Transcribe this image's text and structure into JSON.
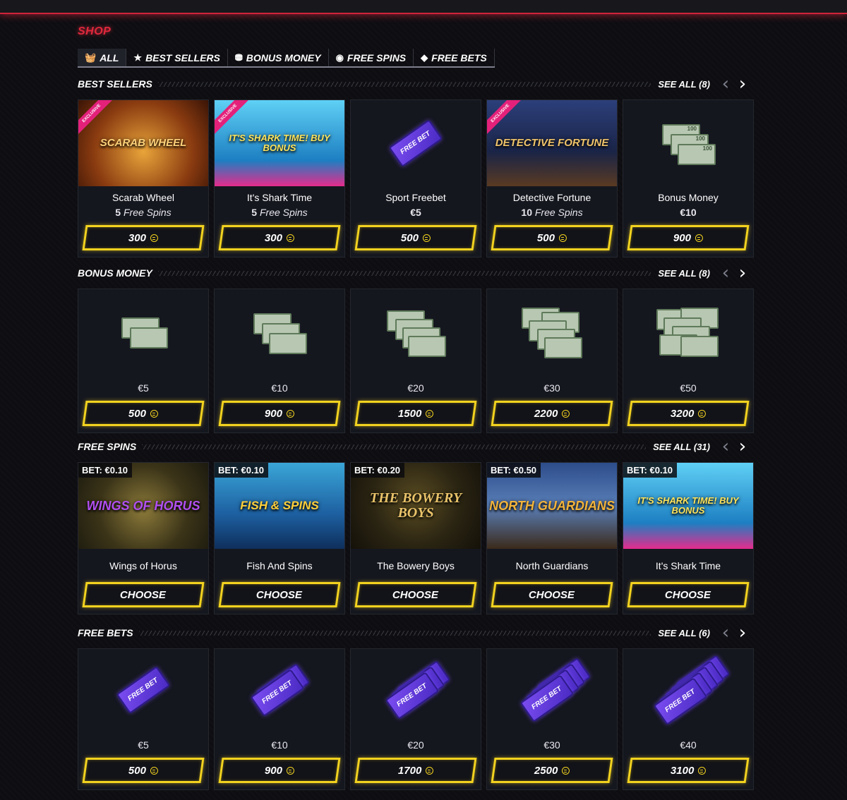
{
  "shop_title": "SHOP",
  "tabs": [
    {
      "icon": "basket-icon",
      "label": "ALL"
    },
    {
      "icon": "star-icon",
      "label": "BEST SELLERS"
    },
    {
      "icon": "coins-icon",
      "label": "BONUS MONEY"
    },
    {
      "icon": "spin-icon",
      "label": "FREE SPINS"
    },
    {
      "icon": "ticket-icon",
      "label": "FREE BETS"
    }
  ],
  "sections": {
    "best_sellers": {
      "title": "BEST SELLERS",
      "see_all": "SEE ALL (8)",
      "items": [
        {
          "image_label": "SCARAB WHEEL",
          "ribbon": "EXCLUSIVE",
          "name": "Scarab Wheel",
          "sub_num": "5",
          "sub_text": " Free Spins",
          "price": "300"
        },
        {
          "image_label": "IT'S SHARK TIME! BUY BONUS",
          "ribbon": "EXCLUSIVE",
          "name": "It's Shark Time",
          "sub_num": "5",
          "sub_text": " Free Spins",
          "price": "300"
        },
        {
          "image_label": "FREE BET",
          "ribbon": "",
          "name": "Sport Freebet",
          "sub_num": "€5",
          "sub_text": "",
          "price": "500"
        },
        {
          "image_label": "DETECTIVE FORTUNE",
          "ribbon": "EXCLUSIVE",
          "name": "Detective Fortune",
          "sub_num": "10",
          "sub_text": " Free Spins",
          "price": "500"
        },
        {
          "image_label": "100",
          "ribbon": "",
          "name": "Bonus Money",
          "sub_num": "€10",
          "sub_text": "",
          "price": "900"
        }
      ]
    },
    "bonus_money": {
      "title": "BONUS MONEY",
      "see_all": "SEE ALL (8)",
      "items": [
        {
          "value": "€5",
          "price": "500"
        },
        {
          "value": "€10",
          "price": "900"
        },
        {
          "value": "€20",
          "price": "1500"
        },
        {
          "value": "€30",
          "price": "2200"
        },
        {
          "value": "€50",
          "price": "3200"
        }
      ]
    },
    "free_spins": {
      "title": "FREE SPINS",
      "see_all": "SEE ALL (31)",
      "items": [
        {
          "bet": "BET: €0.10",
          "image_label": "WINGS OF HORUS",
          "name": "Wings of Horus",
          "button": "CHOOSE"
        },
        {
          "bet": "BET: €0.10",
          "image_label": "FISH & SPINS",
          "name": "Fish And Spins",
          "button": "CHOOSE"
        },
        {
          "bet": "BET: €0.20",
          "image_label": "THE BOWERY BOYS",
          "name": "The Bowery Boys",
          "button": "CHOOSE"
        },
        {
          "bet": "BET: €0.50",
          "image_label": "NORTH GUARDIANS",
          "name": "North Guardians",
          "button": "CHOOSE"
        },
        {
          "bet": "BET: €0.10",
          "image_label": "IT'S SHARK TIME! BUY BONUS",
          "name": "It's Shark Time",
          "button": "CHOOSE"
        }
      ]
    },
    "free_bets": {
      "title": "FREE BETS",
      "see_all": "SEE ALL (6)",
      "items": [
        {
          "image_label": "FREE BET",
          "value": "€5",
          "price": "500"
        },
        {
          "image_label": "FREE BET",
          "value": "€10",
          "price": "900"
        },
        {
          "image_label": "FREE BET",
          "value": "€20",
          "price": "1700"
        },
        {
          "image_label": "FREE BET",
          "value": "€30",
          "price": "2500"
        },
        {
          "image_label": "FREE BET",
          "value": "€40",
          "price": "3100"
        }
      ]
    }
  },
  "colors": {
    "accent_red": "#e0283c",
    "button_yellow": "#f2d21f",
    "ribbon_pink": "#e3217a"
  }
}
